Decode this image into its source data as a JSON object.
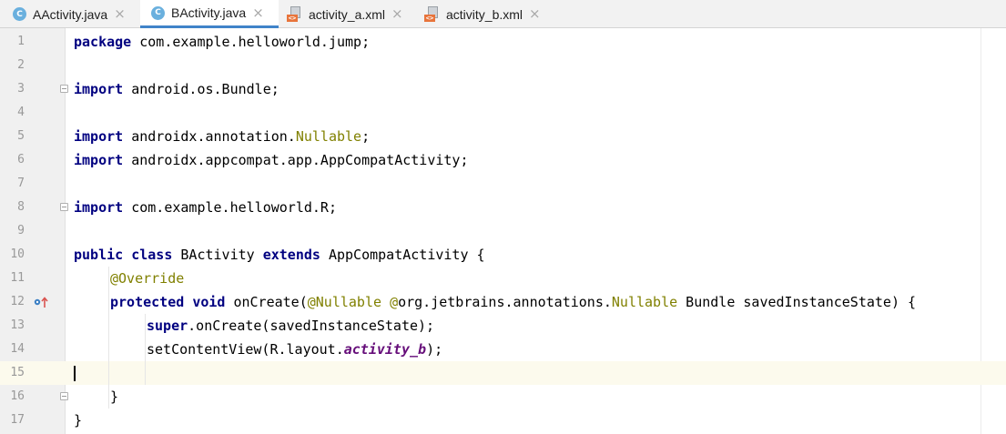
{
  "tabs": [
    {
      "label": "AActivity.java",
      "type": "java",
      "active": false
    },
    {
      "label": "BActivity.java",
      "type": "java",
      "active": true
    },
    {
      "label": "activity_a.xml",
      "type": "xml",
      "active": false
    },
    {
      "label": "activity_b.xml",
      "type": "xml",
      "active": false
    }
  ],
  "icons": {
    "java_letter": "C",
    "xml_tag": "<>",
    "close": "×"
  },
  "lines": [
    "1",
    "2",
    "3",
    "4",
    "5",
    "6",
    "7",
    "8",
    "9",
    "10",
    "11",
    "12",
    "13",
    "14",
    "15",
    "16",
    "17"
  ],
  "code": {
    "l1_kw": "package",
    "l1_rest": " com.example.helloworld.jump;",
    "l3_kw": "import",
    "l3_rest": " android.os.Bundle;",
    "l5_kw": "import",
    "l5_a": " androidx.annotation.",
    "l5_ann": "Nullable",
    "l5_b": ";",
    "l6_kw": "import",
    "l6_rest": " androidx.appcompat.app.AppCompatActivity;",
    "l8_kw": "import",
    "l8_rest": " com.example.helloworld.R;",
    "l10_kw1": "public",
    "l10_sp1": " ",
    "l10_kw2": "class",
    "l10_a": " BActivity ",
    "l10_kw3": "extends",
    "l10_b": " AppCompatActivity {",
    "l11_ann": "@Override",
    "l12_kw1": "protected",
    "l12_sp": " ",
    "l12_kw2": "void",
    "l12_a": " onCreate(",
    "l12_ann1": "@Nullable",
    "l12_b": " ",
    "l12_ann2": "@",
    "l12_c": "org.jetbrains.annotations.",
    "l12_ann3": "Nullable",
    "l12_d": " Bundle savedInstanceState) {",
    "l13_kw": "super",
    "l13_rest": ".onCreate(savedInstanceState);",
    "l14_a": "setContentView(R.layout.",
    "l14_field": "activity_b",
    "l14_b": ");",
    "l16": "}",
    "l17": "}"
  },
  "colors": {
    "keyword": "#000080",
    "annotation": "#808000",
    "field": "#660e7a",
    "current_line": "#fcfaed",
    "tab_underline": "#4083c9"
  }
}
